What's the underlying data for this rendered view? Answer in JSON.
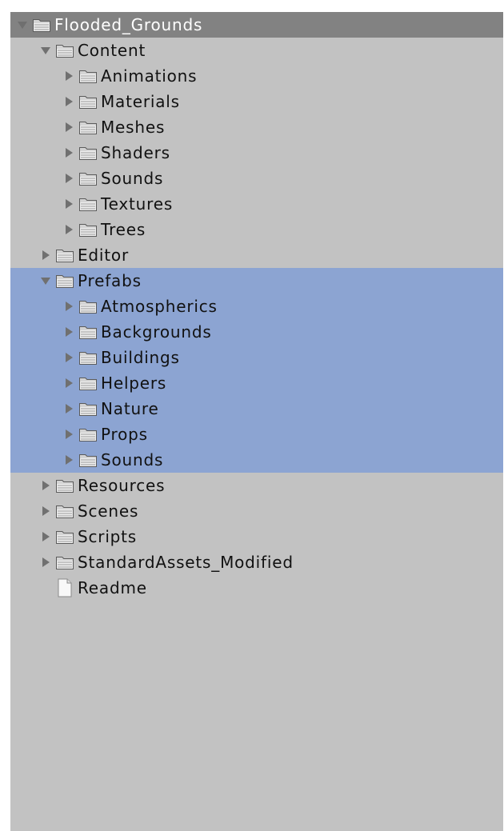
{
  "tree": [
    {
      "label": "Flooded_Grounds",
      "depth": 0,
      "type": "folder",
      "expanded": true,
      "root": true
    },
    {
      "label": "Content",
      "depth": 1,
      "type": "folder",
      "expanded": true
    },
    {
      "label": "Animations",
      "depth": 2,
      "type": "folder",
      "expanded": false
    },
    {
      "label": "Materials",
      "depth": 2,
      "type": "folder",
      "expanded": false
    },
    {
      "label": "Meshes",
      "depth": 2,
      "type": "folder",
      "expanded": false
    },
    {
      "label": "Shaders",
      "depth": 2,
      "type": "folder",
      "expanded": false
    },
    {
      "label": "Sounds",
      "depth": 2,
      "type": "folder",
      "expanded": false
    },
    {
      "label": "Textures",
      "depth": 2,
      "type": "folder",
      "expanded": false
    },
    {
      "label": "Trees",
      "depth": 2,
      "type": "folder",
      "expanded": false
    },
    {
      "label": "Editor",
      "depth": 1,
      "type": "folder",
      "expanded": false
    },
    {
      "label": "Prefabs",
      "depth": 1,
      "type": "folder",
      "expanded": true,
      "selected": true
    },
    {
      "label": "Atmospherics",
      "depth": 2,
      "type": "folder",
      "expanded": false,
      "selected": true
    },
    {
      "label": "Backgrounds",
      "depth": 2,
      "type": "folder",
      "expanded": false,
      "selected": true
    },
    {
      "label": "Buildings",
      "depth": 2,
      "type": "folder",
      "expanded": false,
      "selected": true
    },
    {
      "label": "Helpers",
      "depth": 2,
      "type": "folder",
      "expanded": false,
      "selected": true
    },
    {
      "label": "Nature",
      "depth": 2,
      "type": "folder",
      "expanded": false,
      "selected": true
    },
    {
      "label": "Props",
      "depth": 2,
      "type": "folder",
      "expanded": false,
      "selected": true
    },
    {
      "label": "Sounds",
      "depth": 2,
      "type": "folder",
      "expanded": false,
      "selected": true
    },
    {
      "label": "Resources",
      "depth": 1,
      "type": "folder",
      "expanded": false
    },
    {
      "label": "Scenes",
      "depth": 1,
      "type": "folder",
      "expanded": false
    },
    {
      "label": "Scripts",
      "depth": 1,
      "type": "folder",
      "expanded": false
    },
    {
      "label": "StandardAssets_Modified",
      "depth": 1,
      "type": "folder",
      "expanded": false
    },
    {
      "label": "Readme",
      "depth": 1,
      "type": "file"
    }
  ],
  "colors": {
    "panel_bg": "#c2c2c2",
    "root_row_bg": "#828282",
    "selection_bg": "#8ca4d2",
    "text": "#111111",
    "root_text": "#ffffff"
  }
}
